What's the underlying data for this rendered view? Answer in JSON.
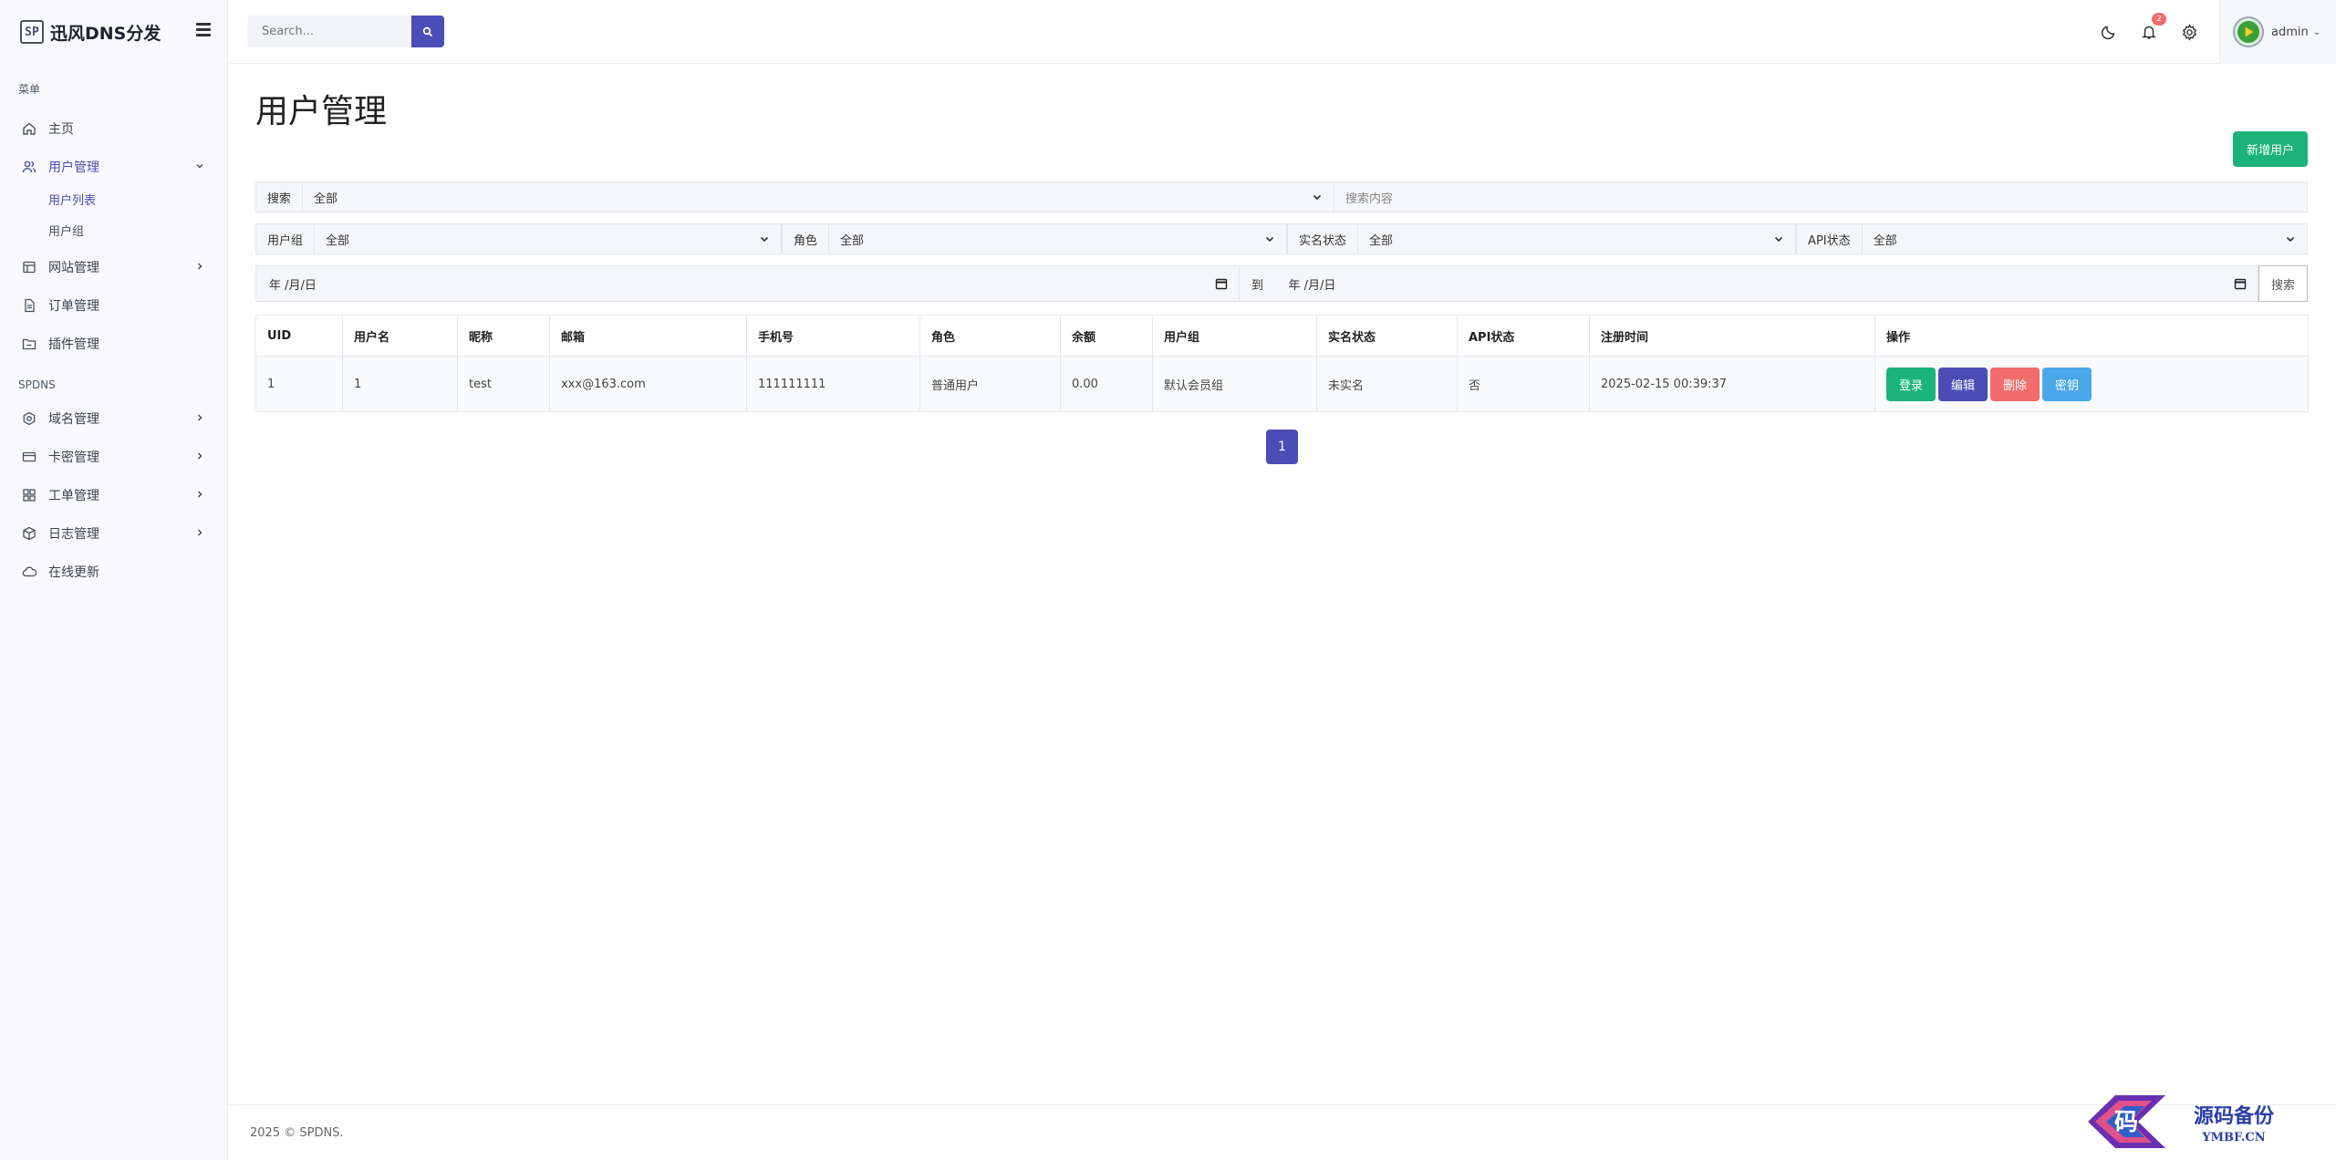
{
  "brand": {
    "logo": "SP",
    "name": "迅风DNS分发"
  },
  "sidebar": {
    "menu_header": "菜单",
    "items": [
      {
        "label": "主页",
        "icon": "home-icon"
      },
      {
        "label": "用户管理",
        "icon": "users-icon",
        "expanded": true
      },
      {
        "label": "网站管理",
        "icon": "table-icon"
      },
      {
        "label": "订单管理",
        "icon": "file-icon"
      },
      {
        "label": "插件管理",
        "icon": "folder-icon"
      }
    ],
    "sub_items": [
      {
        "label": "用户列表"
      },
      {
        "label": "用户组"
      }
    ],
    "section_header": "SPDNS",
    "section_items": [
      {
        "label": "域名管理",
        "icon": "hexagon-icon"
      },
      {
        "label": "卡密管理",
        "icon": "card-icon"
      },
      {
        "label": "工单管理",
        "icon": "grid-icon"
      },
      {
        "label": "日志管理",
        "icon": "box-icon"
      },
      {
        "label": "在线更新",
        "icon": "cloud-icon"
      }
    ]
  },
  "topbar": {
    "search_placeholder": "Search...",
    "notification_count": "2",
    "user_name": "admin"
  },
  "page": {
    "title": "用户管理",
    "add_button": "新增用户"
  },
  "filters": {
    "search_label": "搜索",
    "search_scope": "全部",
    "search_placeholder": "搜索内容",
    "group_label": "用户组",
    "group_value": "全部",
    "role_label": "角色",
    "role_value": "全部",
    "realname_label": "实名状态",
    "realname_value": "全部",
    "api_label": "API状态",
    "api_value": "全部",
    "date_from": "年 /月/日",
    "date_to_label": "到",
    "date_to": "年 /月/日",
    "search_button": "搜索"
  },
  "table": {
    "headers": [
      "UID",
      "用户名",
      "昵称",
      "邮箱",
      "手机号",
      "角色",
      "余额",
      "用户组",
      "实名状态",
      "API状态",
      "注册时间",
      "操作"
    ],
    "rows": [
      {
        "uid": "1",
        "username": "1",
        "nickname": "test",
        "email": "xxx@163.com",
        "phone": "111111111",
        "role": "普通用户",
        "balance": "0.00",
        "group": "默认会员组",
        "realname": "未实名",
        "api": "否",
        "registered": "2025-02-15 00:39:37"
      }
    ],
    "actions": {
      "login": {
        "label": "登录",
        "color": "#1bb37c"
      },
      "edit": {
        "label": "编辑",
        "color": "#4a4db6"
      },
      "delete": {
        "label": "删除",
        "color": "#f16c6c"
      },
      "key": {
        "label": "密钥",
        "color": "#4aa8ea"
      }
    }
  },
  "pagination": {
    "current": "1"
  },
  "footer": {
    "text": "2025 © SPDNS."
  },
  "watermark": {
    "text": "源码备份",
    "sub": "YMBF.CN",
    "glyph": "码"
  },
  "colors": {
    "primary": "#4a4db6",
    "success": "#1bb37c",
    "danger": "#f16c6c",
    "info": "#4aa8ea"
  }
}
